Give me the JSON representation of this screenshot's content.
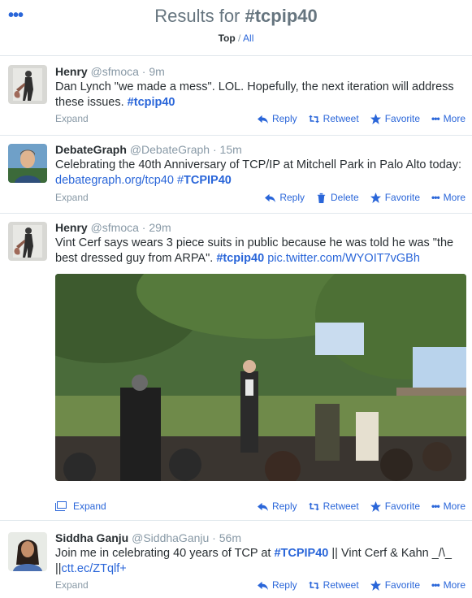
{
  "header": {
    "title_prefix": "Results for ",
    "hashtag": "#tcpip40",
    "filter_top": "Top",
    "filter_sep": " / ",
    "filter_all": "All"
  },
  "tweets": [
    {
      "name": "Henry",
      "handle": "@sfmoca",
      "sep": " · ",
      "time": "9m",
      "text_plain": "Dan Lynch \"we made a mess\". LOL. Hopefully, the next iteration will address these issues. ",
      "text_tag": "#tcpip40",
      "expand": "Expand",
      "actions": [
        "Reply",
        "Retweet",
        "Favorite",
        "More"
      ]
    },
    {
      "name": "DebateGraph",
      "handle": "@DebateGraph",
      "sep": " · ",
      "time": "15m",
      "text_plain": "Celebrating the 40th Anniversary of TCP/IP at Mitchell Park in Palo Alto today: ",
      "link": "debategraph.org/tcp40",
      "text_tag_prefix": " #",
      "text_tag": "TCPIP40",
      "expand": "Expand",
      "actions": [
        "Reply",
        "Delete",
        "Favorite",
        "More"
      ]
    },
    {
      "name": "Henry",
      "handle": "@sfmoca",
      "sep": " · ",
      "time": "29m",
      "text_plain": "Vint Cerf says wears 3 piece suits in public because he was told he was \"the best dressed guy from ARPA\". ",
      "text_tag": "#tcpip40",
      "link": "pic.twitter.com/WYOIT7vGBh",
      "expand": "Expand",
      "actions": [
        "Reply",
        "Retweet",
        "Favorite",
        "More"
      ]
    },
    {
      "name": "Siddha Ganju",
      "handle": "@SiddhaGanju",
      "sep": " · ",
      "time": "56m",
      "text_plain": "Join me in celebrating 40 years of TCP at ",
      "text_tag": "#TCPIP40",
      "text_after": " || Vint Cerf & Kahn _/\\_ ||",
      "link": "ctt.ec/ZTqlf+",
      "expand": "Expand",
      "actions": [
        "Reply",
        "Retweet",
        "Favorite",
        "More"
      ]
    }
  ],
  "colors": {
    "accent": "#2a66d9",
    "muted": "#8899a6",
    "text": "#292f33",
    "divider": "#e1e8ed"
  }
}
